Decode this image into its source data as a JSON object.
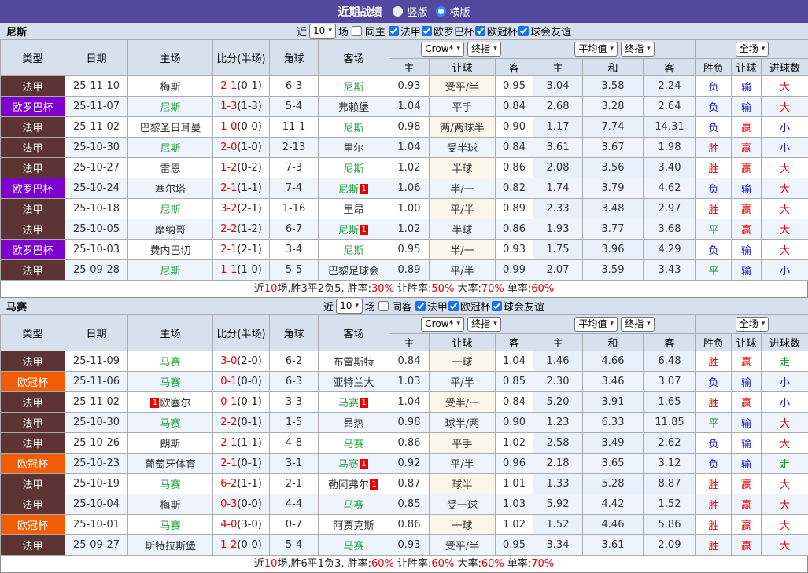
{
  "titlebar": {
    "title": "近期战绩",
    "vertical": "竖版",
    "horizontal": "横版"
  },
  "colors": {
    "accent_purple": "#54489E",
    "ligue1_badge": "#5C3433",
    "europa_badge": "#7D00CF",
    "ucl_badge": "#F25C02",
    "win_red": "#E60000",
    "draw_green": "#1E8E1E",
    "lose_blue": "#1515CE"
  },
  "headers": {
    "type": "类型",
    "date": "日期",
    "home": "主场",
    "score": "比分(半场)",
    "corner": "角球",
    "away": "客场",
    "sel_crow": "Crow*",
    "sel_final": "终指",
    "sel_avg": "平均值",
    "sel_final2": "终指",
    "sel_full": "全场",
    "crow_home": "主",
    "crow_hcap": "让球",
    "crow_away": "客",
    "avg_home": "主",
    "avg_draw": "和",
    "avg_away": "客",
    "res_wl": "胜负",
    "res_hcap": "让球",
    "res_goals": "进球数"
  },
  "table1": {
    "team": "尼斯",
    "filter": {
      "near": "近",
      "count": "10",
      "games": "场",
      "same": "同主",
      "leagues": [
        {
          "label": "法甲"
        },
        {
          "label": "欧罗巴杯"
        },
        {
          "label": "欧冠杯"
        },
        {
          "label": "球会友谊"
        }
      ]
    },
    "rows": [
      {
        "t": "法甲",
        "d": "25-11-10",
        "h": "梅斯",
        "s": "2-1",
        "sh": "(0-1)",
        "c": "6-3",
        "a": "尼斯",
        "as": "y",
        "w1": "0.93",
        "hd": "受平/半",
        "w2": "0.95",
        "m1": "3.04",
        "m2": "3.58",
        "m3": "2.24",
        "r1": "负",
        "r2": "输",
        "r3": "大"
      },
      {
        "t": "欧罗巴杯",
        "d": "25-11-07",
        "h": "尼斯",
        "hs": "y",
        "s": "1-3",
        "sh": "(1-3)",
        "c": "5-4",
        "a": "弗赖堡",
        "w1": "1.04",
        "hd": "平手",
        "w2": "0.84",
        "m1": "2.68",
        "m2": "3.28",
        "m3": "2.64",
        "r1": "负",
        "r2": "输",
        "r3": "大"
      },
      {
        "t": "法甲",
        "d": "25-11-02",
        "h": "巴黎圣日耳曼",
        "s": "1-0",
        "sh": "(0-0)",
        "c": "11-1",
        "a": "尼斯",
        "as": "y",
        "w1": "0.98",
        "hd": "两/两球半",
        "w2": "0.90",
        "m1": "1.17",
        "m2": "7.74",
        "m3": "14.31",
        "r1": "负",
        "r2": "赢",
        "r3": "小"
      },
      {
        "t": "法甲",
        "d": "25-10-30",
        "h": "尼斯",
        "hs": "y",
        "s": "2-0",
        "sh": "(1-0)",
        "c": "2-13",
        "a": "里尔",
        "w1": "1.04",
        "hd": "受半球",
        "w2": "0.84",
        "m1": "3.61",
        "m2": "3.67",
        "m3": "1.98",
        "r1": "胜",
        "r2": "赢",
        "r3": "小"
      },
      {
        "t": "法甲",
        "d": "25-10-27",
        "h": "雷恩",
        "s": "1-2",
        "sh": "(0-2)",
        "c": "7-3",
        "a": "尼斯",
        "as": "y",
        "w1": "1.02",
        "hd": "半球",
        "w2": "0.86",
        "m1": "2.08",
        "m2": "3.56",
        "m3": "3.40",
        "r1": "胜",
        "r2": "赢",
        "r3": "大"
      },
      {
        "t": "欧罗巴杯",
        "d": "25-10-24",
        "h": "塞尔塔",
        "s": "2-1",
        "sh": "(1-1)",
        "c": "7-4",
        "a": "尼斯",
        "as": "y",
        "apost": "1",
        "w1": "1.06",
        "hd": "半/一",
        "w2": "0.82",
        "m1": "1.74",
        "m2": "3.79",
        "m3": "4.62",
        "r1": "负",
        "r2": "输",
        "r3": "大"
      },
      {
        "t": "法甲",
        "d": "25-10-18",
        "h": "尼斯",
        "hs": "y",
        "s": "3-2",
        "sh": "(2-1)",
        "c": "1-16",
        "a": "里昂",
        "w1": "1.00",
        "hd": "平/半",
        "w2": "0.89",
        "m1": "2.33",
        "m2": "3.48",
        "m3": "2.97",
        "r1": "胜",
        "r2": "赢",
        "r3": "大"
      },
      {
        "t": "法甲",
        "d": "25-10-05",
        "h": "摩纳哥",
        "s": "2-2",
        "sh": "(1-2)",
        "c": "6-7",
        "a": "尼斯",
        "as": "y",
        "apost": "1",
        "w1": "1.02",
        "hd": "半球",
        "w2": "0.86",
        "m1": "1.93",
        "m2": "3.77",
        "m3": "3.68",
        "r1": "平",
        "r2": "赢",
        "r3": "大"
      },
      {
        "t": "欧罗巴杯",
        "d": "25-10-03",
        "h": "费内巴切",
        "s": "2-1",
        "sh": "(2-1)",
        "c": "3-4",
        "a": "尼斯",
        "as": "y",
        "w1": "0.95",
        "hd": "半/一",
        "w2": "0.93",
        "m1": "1.75",
        "m2": "3.96",
        "m3": "4.29",
        "r1": "负",
        "r2": "输",
        "r3": "大"
      },
      {
        "t": "法甲",
        "d": "25-09-28",
        "h": "尼斯",
        "hs": "y",
        "s": "1-1",
        "sh": "(1-0)",
        "c": "5-5",
        "a": "巴黎足球会",
        "w1": "0.89",
        "hd": "平/半",
        "w2": "0.99",
        "m1": "2.07",
        "m2": "3.59",
        "m3": "3.43",
        "r1": "平",
        "r2": "输",
        "r3": "小"
      }
    ],
    "summary": [
      {
        "t": "近"
      },
      {
        "t": "10",
        "c": "r"
      },
      {
        "t": "场,胜3平2负5, 胜率:"
      },
      {
        "t": "30%",
        "c": "r"
      },
      {
        "t": " 让胜率:"
      },
      {
        "t": "50%",
        "c": "r"
      },
      {
        "t": " 大率:"
      },
      {
        "t": "70%",
        "c": "r"
      },
      {
        "t": " 单率:"
      },
      {
        "t": "60%",
        "c": "r"
      }
    ]
  },
  "table2": {
    "team": "马赛",
    "filter": {
      "near": "近",
      "count": "10",
      "games": "场",
      "same": "同客",
      "leagues": [
        {
          "label": "法甲"
        },
        {
          "label": "欧冠杯"
        },
        {
          "label": "球会友谊"
        }
      ]
    },
    "rows": [
      {
        "t": "法甲",
        "d": "25-11-09",
        "h": "马赛",
        "hs": "y",
        "s": "3-0",
        "sh": "(2-0)",
        "c": "6-2",
        "a": "布雷斯特",
        "w1": "0.84",
        "hd": "一球",
        "w2": "1.04",
        "m1": "1.46",
        "m2": "4.66",
        "m3": "6.48",
        "r1": "胜",
        "r2": "赢",
        "r3": "走"
      },
      {
        "t": "欧冠杯",
        "d": "25-11-06",
        "h": "马赛",
        "hs": "y",
        "s": "0-1",
        "sh": "(0-0)",
        "c": "6-3",
        "a": "亚特兰大",
        "w1": "1.03",
        "hd": "平/半",
        "w2": "0.85",
        "m1": "2.30",
        "m2": "3.46",
        "m3": "3.07",
        "r1": "负",
        "r2": "输",
        "r3": "小"
      },
      {
        "t": "法甲",
        "d": "25-11-02",
        "h": "欧塞尔",
        "hpre": "1",
        "s": "0-1",
        "sh": "(0-1)",
        "c": "3-3",
        "a": "马赛",
        "as": "y",
        "apost": "1",
        "w1": "1.04",
        "hd": "受半/一",
        "w2": "0.84",
        "m1": "5.20",
        "m2": "3.91",
        "m3": "1.65",
        "r1": "胜",
        "r2": "赢",
        "r3": "小"
      },
      {
        "t": "法甲",
        "d": "25-10-30",
        "h": "马赛",
        "hs": "y",
        "s": "2-2",
        "sh": "(0-1)",
        "c": "1-5",
        "a": "昂热",
        "w1": "0.98",
        "hd": "球半/两",
        "w2": "0.90",
        "m1": "1.23",
        "m2": "6.33",
        "m3": "11.85",
        "r1": "平",
        "r2": "输",
        "r3": "大"
      },
      {
        "t": "法甲",
        "d": "25-10-26",
        "h": "朗斯",
        "s": "2-1",
        "sh": "(1-1)",
        "c": "4-8",
        "a": "马赛",
        "as": "y",
        "w1": "0.86",
        "hd": "平手",
        "w2": "1.02",
        "m1": "2.58",
        "m2": "3.49",
        "m3": "2.62",
        "r1": "负",
        "r2": "输",
        "r3": "大"
      },
      {
        "t": "欧冠杯",
        "d": "25-10-23",
        "h": "葡萄牙体育",
        "s": "2-1",
        "sh": "(0-1)",
        "c": "3-1",
        "a": "马赛",
        "as": "y",
        "apost": "1",
        "w1": "0.92",
        "hd": "平/半",
        "w2": "0.96",
        "m1": "2.18",
        "m2": "3.65",
        "m3": "3.12",
        "r1": "负",
        "r2": "输",
        "r3": "走"
      },
      {
        "t": "法甲",
        "d": "25-10-19",
        "h": "马赛",
        "hs": "y",
        "s": "6-2",
        "sh": "(1-1)",
        "c": "2-1",
        "a": "勒阿弗尔",
        "apost": "1",
        "w1": "0.87",
        "hd": "球半",
        "w2": "1.01",
        "m1": "1.33",
        "m2": "5.28",
        "m3": "8.87",
        "r1": "胜",
        "r2": "赢",
        "r3": "大"
      },
      {
        "t": "法甲",
        "d": "25-10-04",
        "h": "梅斯",
        "s": "0-3",
        "sh": "(0-0)",
        "c": "4-4",
        "a": "马赛",
        "as": "y",
        "w1": "0.85",
        "hd": "受一球",
        "w2": "1.03",
        "m1": "5.92",
        "m2": "4.42",
        "m3": "1.52",
        "r1": "胜",
        "r2": "赢",
        "r3": "大"
      },
      {
        "t": "欧冠杯",
        "d": "25-10-01",
        "h": "马赛",
        "hs": "y",
        "s": "4-0",
        "sh": "(3-0)",
        "c": "0-7",
        "a": "阿贾克斯",
        "w1": "0.86",
        "hd": "一球",
        "w2": "1.02",
        "m1": "1.52",
        "m2": "4.46",
        "m3": "5.86",
        "r1": "胜",
        "r2": "赢",
        "r3": "大"
      },
      {
        "t": "法甲",
        "d": "25-09-27",
        "h": "斯特拉斯堡",
        "s": "1-2",
        "sh": "(0-0)",
        "c": "5-4",
        "a": "马赛",
        "as": "y",
        "w1": "0.93",
        "hd": "受平/半",
        "w2": "0.95",
        "m1": "3.34",
        "m2": "3.61",
        "m3": "2.09",
        "r1": "胜",
        "r2": "赢",
        "r3": "大"
      }
    ],
    "summary": [
      {
        "t": "近"
      },
      {
        "t": "10",
        "c": "r"
      },
      {
        "t": "场,胜6平1负3, 胜率:"
      },
      {
        "t": "60%",
        "c": "r"
      },
      {
        "t": " 让胜率:"
      },
      {
        "t": "60%",
        "c": "r"
      },
      {
        "t": " 大率:"
      },
      {
        "t": "60%",
        "c": "r"
      },
      {
        "t": " 单率:"
      },
      {
        "t": "70%",
        "c": "r"
      }
    ]
  }
}
